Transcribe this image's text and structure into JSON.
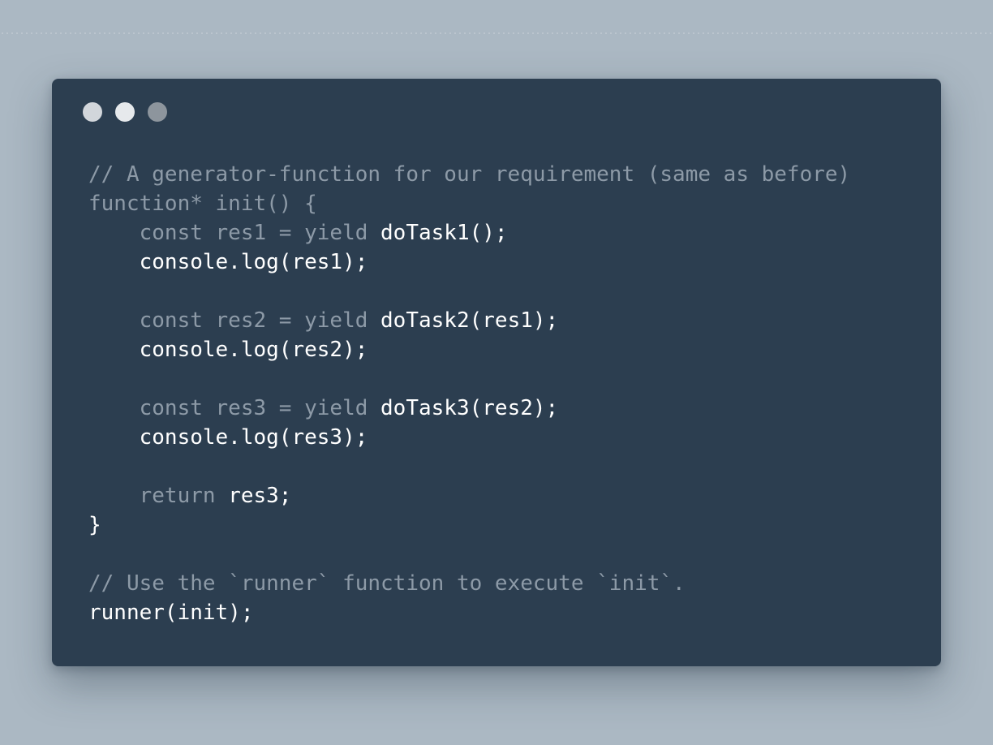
{
  "window": {
    "controls": [
      "window-dot-1",
      "window-dot-2",
      "window-dot-3"
    ]
  },
  "code": {
    "language": "javascript",
    "lines": [
      {
        "tokens": [
          {
            "type": "comment",
            "text": "// A generator-function for our requirement (same as before)"
          }
        ]
      },
      {
        "tokens": [
          {
            "type": "keyword",
            "text": "function* init() {"
          }
        ]
      },
      {
        "tokens": [
          {
            "type": "keyword",
            "text": "    const res1 = yield "
          },
          {
            "type": "plain",
            "text": "doTask1();"
          }
        ]
      },
      {
        "tokens": [
          {
            "type": "plain",
            "text": "    console.log(res1);"
          }
        ]
      },
      {
        "tokens": []
      },
      {
        "tokens": [
          {
            "type": "keyword",
            "text": "    const res2 = yield "
          },
          {
            "type": "plain",
            "text": "doTask2(res1);"
          }
        ]
      },
      {
        "tokens": [
          {
            "type": "plain",
            "text": "    console.log(res2);"
          }
        ]
      },
      {
        "tokens": []
      },
      {
        "tokens": [
          {
            "type": "keyword",
            "text": "    const res3 = yield "
          },
          {
            "type": "plain",
            "text": "doTask3(res2);"
          }
        ]
      },
      {
        "tokens": [
          {
            "type": "plain",
            "text": "    console.log(res3);"
          }
        ]
      },
      {
        "tokens": []
      },
      {
        "tokens": [
          {
            "type": "keyword",
            "text": "    return "
          },
          {
            "type": "plain",
            "text": "res3;"
          }
        ]
      },
      {
        "tokens": [
          {
            "type": "plain",
            "text": "}"
          }
        ]
      },
      {
        "tokens": []
      },
      {
        "tokens": [
          {
            "type": "comment",
            "text": "// Use the `runner` function to execute `init`."
          }
        ]
      },
      {
        "tokens": [
          {
            "type": "plain",
            "text": "runner(init);"
          }
        ]
      }
    ]
  },
  "colors": {
    "background": "#abb8c3",
    "window": "#2c3e50",
    "comment": "#8d9aa7",
    "keyword": "#8d9aa7",
    "plain": "#ffffff"
  }
}
